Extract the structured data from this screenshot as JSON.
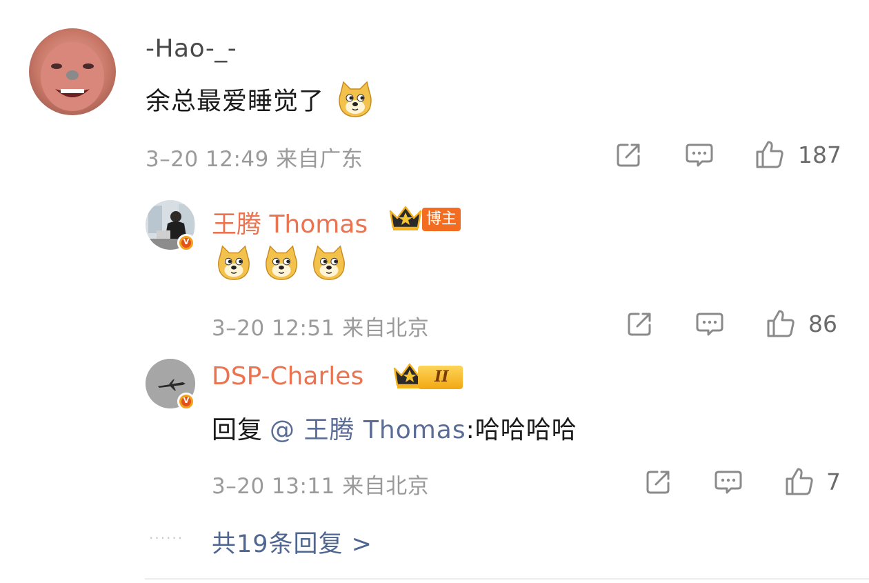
{
  "comment": {
    "user": "-Hao-_-",
    "text": "余总最爱睡觉了",
    "emoji": "doge-emoji",
    "meta": "3–20 12:49 来自广东",
    "likes": "187"
  },
  "reply1": {
    "user": "王腾 Thomas",
    "badge": "博主",
    "emojis": [
      "doge-emoji",
      "doge-emoji",
      "doge-emoji"
    ],
    "meta": "3–20 12:51 来自北京",
    "likes": "86"
  },
  "reply2": {
    "user": "DSP-Charles",
    "level": "II",
    "reply_prefix": "回复",
    "mention": "@ 王腾 Thomas",
    "text": ":哈哈哈哈",
    "meta": "3–20 13:11 来自北京",
    "likes": "7"
  },
  "more_replies": "共19条回复 >",
  "icons": {
    "share": "share-icon",
    "comment": "comment-icon",
    "like": "thumbs-up-icon",
    "verified": "verified-v-icon",
    "crown": "crown-icon"
  },
  "colors": {
    "username_highlight": "#eb7350",
    "mention": "#5b6d96",
    "meta": "#9a9a9a"
  }
}
